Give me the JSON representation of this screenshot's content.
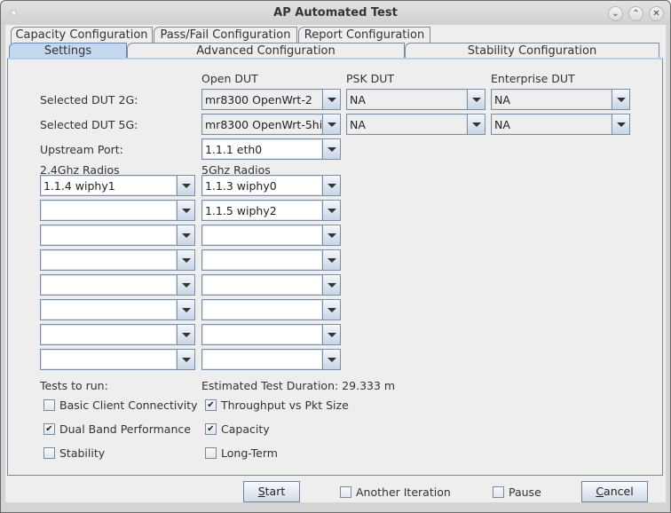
{
  "window": {
    "title": "AP Automated Test",
    "controls": [
      "minimize",
      "maximize",
      "close"
    ]
  },
  "tabs": {
    "row_top": [
      {
        "label": "Capacity Configuration"
      },
      {
        "label": "Pass/Fail Configuration"
      },
      {
        "label": "Report Configuration"
      }
    ],
    "row_bottom": [
      {
        "label": "Settings",
        "selected": true
      },
      {
        "label": "Advanced Configuration"
      },
      {
        "label": "Stability Configuration"
      }
    ]
  },
  "settings": {
    "col_headers": {
      "open_dut": "Open DUT",
      "psk_dut": "PSK DUT",
      "enterprise_dut": "Enterprise DUT"
    },
    "dut_2g": {
      "label": "Selected DUT 2G:",
      "open": "mr8300 OpenWrt-2",
      "psk": "NA",
      "enterprise": "NA"
    },
    "dut_5g": {
      "label": "Selected DUT 5G:",
      "open": "mr8300 OpenWrt-5hi",
      "psk": "NA",
      "enterprise": "NA"
    },
    "upstream": {
      "label": "Upstream Port:",
      "value": "1.1.1 eth0"
    },
    "radios_24_label": "2.4Ghz Radios",
    "radios_5_label": "5Ghz Radios",
    "radios_24": [
      "1.1.4 wiphy1",
      "",
      "",
      "",
      "",
      "",
      "",
      ""
    ],
    "radios_5": [
      "1.1.3 wiphy0",
      "1.1.5 wiphy2",
      "",
      "",
      "",
      "",
      "",
      ""
    ],
    "tests_label": "Tests to run:",
    "duration_label": "Estimated Test Duration: 29.333 m",
    "tests": [
      {
        "label": "Basic Client Connectivity",
        "checked": false
      },
      {
        "label": "Throughput vs Pkt Size",
        "checked": true
      },
      {
        "label": "Dual Band Performance",
        "checked": true
      },
      {
        "label": "Capacity",
        "checked": true
      },
      {
        "label": "Stability",
        "checked": false
      },
      {
        "label": "Long-Term",
        "checked": false
      }
    ]
  },
  "footer": {
    "start_label": "Start",
    "start_mnemonic": "S",
    "another_iteration": {
      "label": "Another Iteration",
      "checked": false
    },
    "pause": {
      "label": "Pause",
      "checked": false
    },
    "cancel_label": "Cancel",
    "cancel_mnemonic": "C"
  },
  "icons": {
    "check": "✔",
    "minimize": "⌄",
    "maximize": "⌃",
    "close": "✕"
  }
}
